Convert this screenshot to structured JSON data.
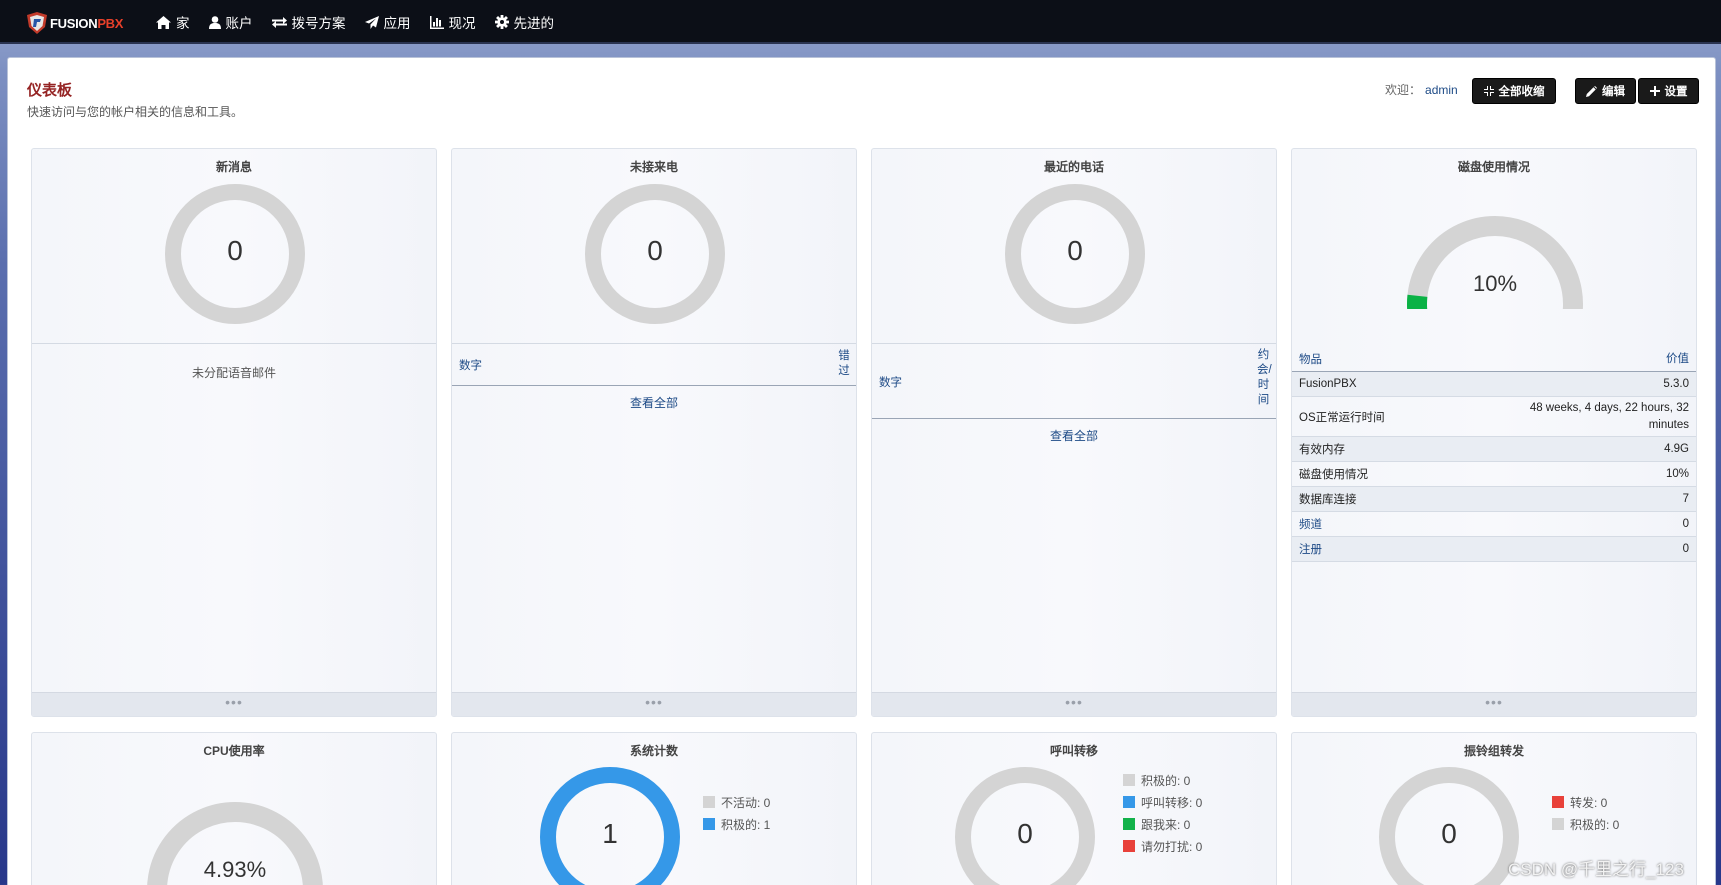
{
  "app": {
    "logo_a": "FUSION",
    "logo_b": "PBX"
  },
  "nav": [
    {
      "label": "家",
      "icon": "home-icon"
    },
    {
      "label": "账户",
      "icon": "user-icon"
    },
    {
      "label": "拨号方案",
      "icon": "exchange-icon"
    },
    {
      "label": "应用",
      "icon": "paper-plane-icon"
    },
    {
      "label": "现况",
      "icon": "bar-chart-icon"
    },
    {
      "label": "先进的",
      "icon": "gear-icon"
    }
  ],
  "header": {
    "title": "仪表板",
    "subtitle": "快速访问与您的帐户相关的信息和工具。",
    "welcome": "欢迎：",
    "user": "admin",
    "collapse_label": "全部收缩",
    "edit_label": "编辑",
    "settings_label": "设置"
  },
  "widgets": {
    "voicemail": {
      "title": "新消息",
      "count": "0",
      "body": "未分配语音邮件",
      "ring_color": "#d4d4d4"
    },
    "missed": {
      "title": "未接来电",
      "count": "0",
      "col_number": "数字",
      "col_right": "错过",
      "view_all": "查看全部"
    },
    "recent": {
      "title": "最近的电话",
      "count": "0",
      "col_number": "数字",
      "col_right": "约会/时间",
      "view_all": "查看全部"
    },
    "disk": {
      "title": "磁盘使用情况",
      "percent_label": "10%",
      "percent": 10,
      "fill_color": "#0ab245",
      "track_color": "#d4d4d4",
      "table_head": {
        "k": "物品",
        "v": "价值"
      },
      "rows": [
        {
          "k": "FusionPBX",
          "v": "5.3.0"
        },
        {
          "k": "OS正常运行时间",
          "v": "48 weeks, 4 days, 22 hours, 32 minutes"
        },
        {
          "k": "有效内存",
          "v": "4.9G"
        },
        {
          "k": "磁盘使用情况",
          "v": "10%"
        },
        {
          "k": "数据库连接",
          "v": "7"
        },
        {
          "k": "频道",
          "v": "0"
        },
        {
          "k": "注册",
          "v": "0"
        }
      ]
    },
    "cpu": {
      "title": "CPU使用率",
      "percent_label": "4.93%",
      "percent": 4.93
    },
    "system": {
      "title": "系统计数",
      "count": "1",
      "ring_color": "#3598e8",
      "legend": [
        {
          "label": "不活动: 0",
          "color": "#d4d4d4"
        },
        {
          "label": "积极的: 1",
          "color": "#3598e8"
        }
      ]
    },
    "forward": {
      "title": "呼叫转移",
      "count": "0",
      "legend": [
        {
          "label": "积极的: 0",
          "color": "#d4d4d4"
        },
        {
          "label": "呼叫转移: 0",
          "color": "#3598e8"
        },
        {
          "label": "跟我来: 0",
          "color": "#12b24a"
        },
        {
          "label": "请勿打扰: 0",
          "color": "#e8413a"
        }
      ]
    },
    "ringgroup": {
      "title": "振铃组转发",
      "count": "0",
      "legend": [
        {
          "label": "转发: 0",
          "color": "#e8413a"
        },
        {
          "label": "积极的: 0",
          "color": "#d4d4d4"
        }
      ]
    }
  },
  "footer_dots": "•••",
  "watermark": "CSDN @千里之行_123"
}
